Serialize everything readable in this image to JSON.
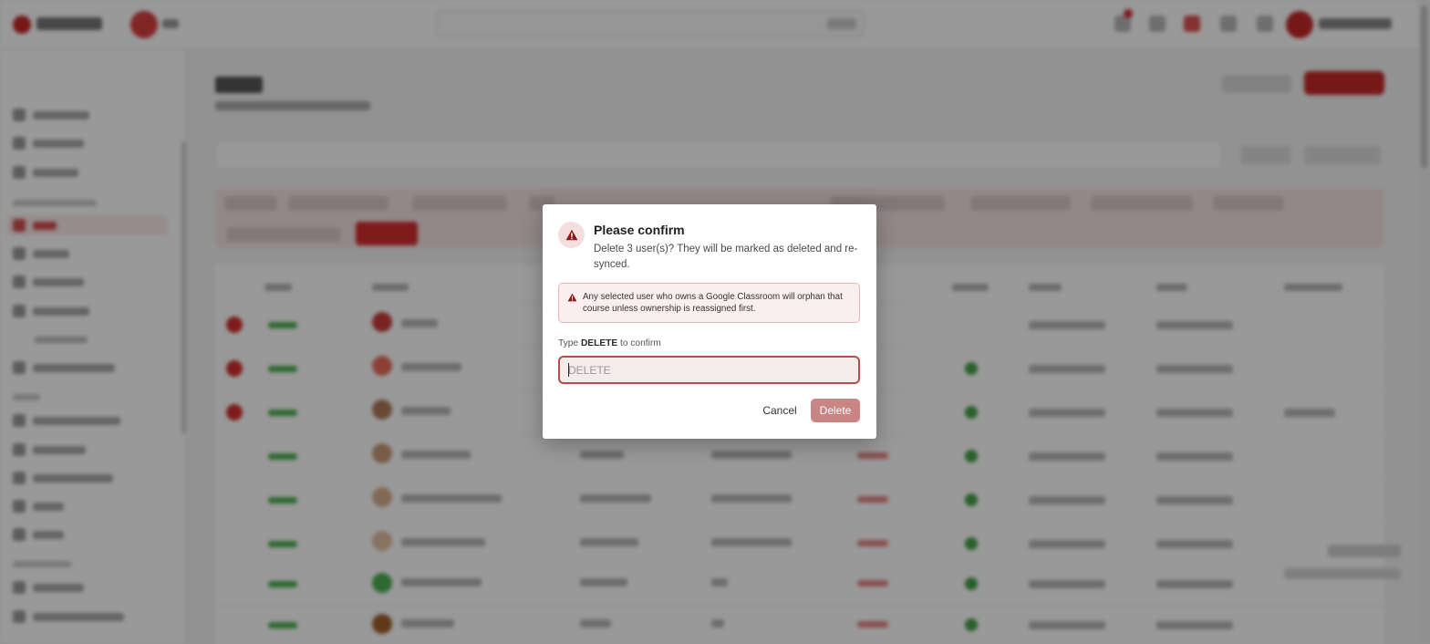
{
  "dialog": {
    "title": "Please confirm",
    "message": "Delete 3 user(s)? They will be marked as deleted and re-synced.",
    "warning": "Any selected user who owns a Google Classroom will orphan that course unless ownership is reassigned first.",
    "type_prefix": "Type",
    "type_keyword": "DELETE",
    "type_suffix": "to confirm",
    "input_placeholder": "DELETE",
    "input_value": "",
    "cancel_label": "Cancel",
    "delete_label": "Delete",
    "icon": "warning-triangle-icon"
  },
  "colors": {
    "danger": "#b84b4b",
    "delete_button": "#c98584",
    "warning_bg": "#fbeeee",
    "brand": "#c62828",
    "success": "#43a047"
  }
}
